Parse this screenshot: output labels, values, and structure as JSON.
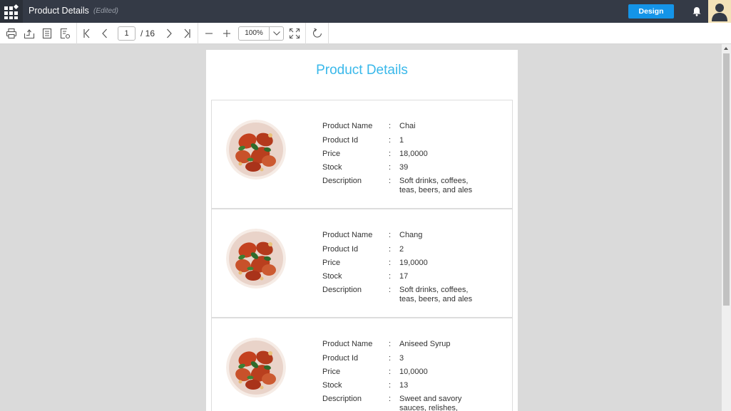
{
  "header": {
    "title": "Product Details",
    "status": "(Edited)",
    "design_label": "Design",
    "accent_color": "#1494e8",
    "bar_color": "#343a46"
  },
  "toolbar": {
    "current_page": "1",
    "total_pages": "/ 16",
    "zoom": "100%",
    "icons": [
      "print-icon",
      "export-icon",
      "page-setup-icon",
      "parameters-icon",
      "first-page-icon",
      "previous-page-icon",
      "next-page-icon",
      "last-page-icon",
      "zoom-out-icon",
      "zoom-in-icon",
      "fit-page-icon",
      "refresh-icon"
    ]
  },
  "report": {
    "title": "Product Details",
    "title_color": "#39b8ea",
    "labels": {
      "name": "Product Name",
      "id": "Product Id",
      "price": "Price",
      "stock": "Stock",
      "description": "Description",
      "separator": ":"
    },
    "products": [
      {
        "name": "Chai",
        "id": "1",
        "price": "18,0000",
        "stock": "39",
        "description": "Soft drinks, coffees, teas, beers, and ales"
      },
      {
        "name": "Chang",
        "id": "2",
        "price": "19,0000",
        "stock": "17",
        "description": "Soft drinks, coffees, teas, beers, and ales"
      },
      {
        "name": "Aniseed Syrup",
        "id": "3",
        "price": "10,0000",
        "stock": "13",
        "description": "Sweet and savory sauces, relishes,"
      }
    ]
  }
}
